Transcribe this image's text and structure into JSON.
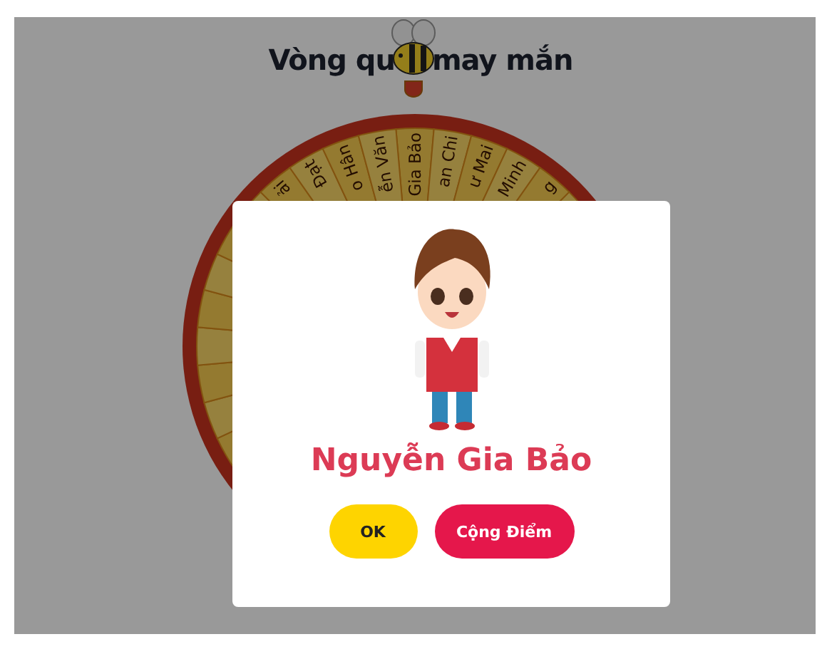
{
  "page": {
    "title_parts": [
      "Vòng qu",
      "may mắn"
    ]
  },
  "wheel": {
    "labels": [
      "ải",
      "Đạt",
      "o Hân",
      "ễn Văn",
      "Gia Bảo",
      "an Chi",
      "ư Mai",
      "Minh",
      "g"
    ]
  },
  "dialog": {
    "name": "Nguyễn Gia Bảo",
    "buttons": [
      {
        "label": "OK",
        "kind": "secondary"
      },
      {
        "label": "Cộng Điểm",
        "kind": "primary"
      }
    ]
  }
}
